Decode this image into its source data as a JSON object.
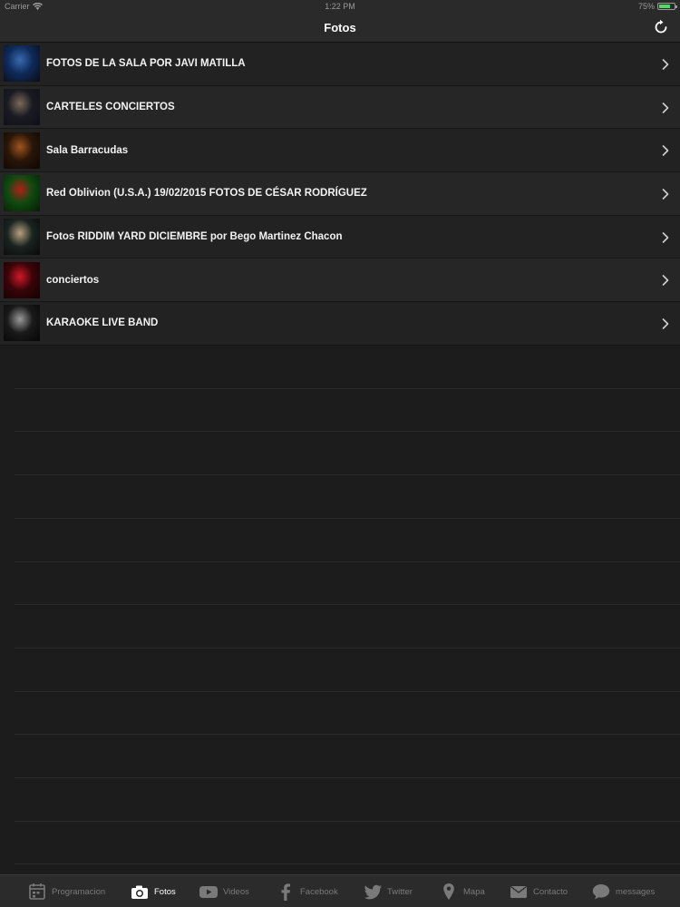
{
  "status_bar": {
    "carrier": "Carrier",
    "time": "1:22 PM",
    "battery": "75%",
    "battery_level": 0.75
  },
  "nav": {
    "title": "Fotos"
  },
  "albums": [
    {
      "label": "FOTOS DE LA SALA POR JAVI MATILLA",
      "thumb_colors": [
        "#0e2a5a",
        "#3a6ab0",
        "#0b0b14"
      ]
    },
    {
      "label": "CARTELES CONCIERTOS",
      "thumb_colors": [
        "#1a1a22",
        "#7a6a58",
        "#0d0f18"
      ]
    },
    {
      "label": "Sala Barracudas",
      "thumb_colors": [
        "#2a1608",
        "#a05520",
        "#0c0604"
      ]
    },
    {
      "label": "Red Oblivion (U.S.A.) 19/02/2015 FOTOS DE CÉSAR RODRÍGUEZ",
      "thumb_colors": [
        "#0e4a10",
        "#b02018",
        "#0a1a06"
      ]
    },
    {
      "label": "Fotos RIDDIM YARD DICIEMBRE por Bego Martinez Chacon",
      "thumb_colors": [
        "#1a2420",
        "#b8a080",
        "#080808"
      ]
    },
    {
      "label": "conciertos",
      "thumb_colors": [
        "#3a0408",
        "#d01828",
        "#100204"
      ]
    },
    {
      "label": "KARAOKE LIVE BAND",
      "thumb_colors": [
        "#1a1a1a",
        "#9a9a9a",
        "#050505"
      ]
    }
  ],
  "tabs": [
    {
      "label": "Programacion",
      "icon": "calendar-icon",
      "active": false
    },
    {
      "label": "Fotos",
      "icon": "camera-icon",
      "active": true
    },
    {
      "label": "Videos",
      "icon": "youtube-icon",
      "active": false
    },
    {
      "label": "Facebook",
      "icon": "facebook-icon",
      "active": false
    },
    {
      "label": "Twitter",
      "icon": "twitter-icon",
      "active": false
    },
    {
      "label": "Mapa",
      "icon": "map-pin-icon",
      "active": false
    },
    {
      "label": "Contacto",
      "icon": "envelope-icon",
      "active": false
    },
    {
      "label": "messages",
      "icon": "chat-bubble-icon",
      "active": false
    }
  ],
  "colors": {
    "background": "#1c1c1d",
    "bar": "#2a2a2a",
    "accent": "#ffffff",
    "inactive": "#7a7a7a"
  }
}
